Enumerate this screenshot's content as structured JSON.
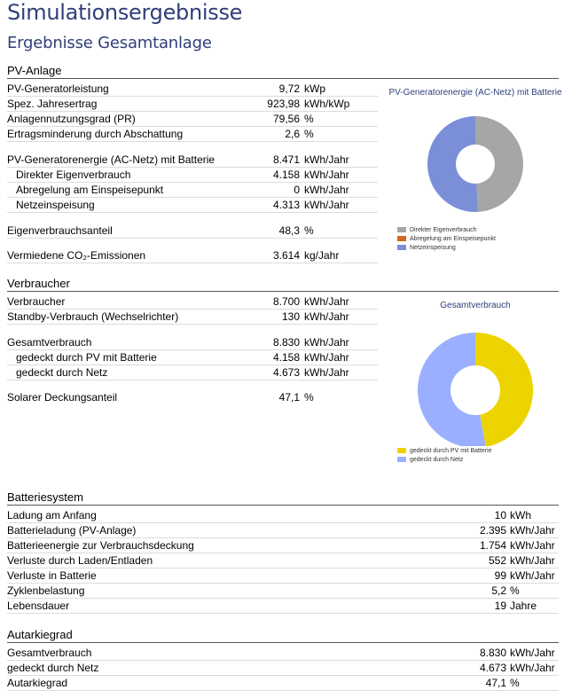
{
  "header": {
    "title": "Simulationsergebnisse",
    "subtitle": "Ergebnisse Gesamtanlage"
  },
  "pv": {
    "title": "PV-Anlage",
    "rows": [
      {
        "label": "PV-Generatorleistung",
        "value": "9,72",
        "unit": "kWp"
      },
      {
        "label": "Spez. Jahresertrag",
        "value": "923,98",
        "unit": "kWh/kWp"
      },
      {
        "label": "Anlagennutzungsgrad (PR)",
        "value": "79,56",
        "unit": "%"
      },
      {
        "label": "Ertragsminderung durch Abschattung",
        "value": "2,6",
        "unit": "%"
      },
      {
        "label": "PV-Generatorenergie (AC-Netz) mit Batterie",
        "value": "8.471",
        "unit": "kWh/Jahr"
      },
      {
        "label": "Direkter Eigenverbrauch",
        "value": "4.158",
        "unit": "kWh/Jahr"
      },
      {
        "label": "Abregelung am Einspeisepunkt",
        "value": "0",
        "unit": "kWh/Jahr"
      },
      {
        "label": "Netzeinspeisung",
        "value": "4.313",
        "unit": "kWh/Jahr"
      },
      {
        "label": "Eigenverbrauchsanteil",
        "value": "48,3",
        "unit": "%"
      },
      {
        "label": "Vermiedene CO₂-Emissionen",
        "value": "3.614",
        "unit": "kg/Jahr"
      }
    ]
  },
  "verbraucher": {
    "title": "Verbraucher",
    "rows": [
      {
        "label": "Verbraucher",
        "value": "8.700",
        "unit": "kWh/Jahr"
      },
      {
        "label": "Standby-Verbrauch (Wechselrichter)",
        "value": "130",
        "unit": "kWh/Jahr"
      },
      {
        "label": "Gesamtverbrauch",
        "value": "8.830",
        "unit": "kWh/Jahr"
      },
      {
        "label": "gedeckt durch PV mit Batterie",
        "value": "4.158",
        "unit": "kWh/Jahr"
      },
      {
        "label": "gedeckt durch Netz",
        "value": "4.673",
        "unit": "kWh/Jahr"
      },
      {
        "label": "Solarer Deckungsanteil",
        "value": "47,1",
        "unit": "%"
      }
    ]
  },
  "batterie": {
    "title": "Batteriesystem",
    "rows": [
      {
        "label": "Ladung am Anfang",
        "value": "10",
        "unit": "kWh"
      },
      {
        "label": "Batterieladung (PV-Anlage)",
        "value": "2.395",
        "unit": "kWh/Jahr"
      },
      {
        "label": "Batterieenergie zur Verbrauchsdeckung",
        "value": "1.754",
        "unit": "kWh/Jahr"
      },
      {
        "label": "Verluste durch Laden/Entladen",
        "value": "552",
        "unit": "kWh/Jahr"
      },
      {
        "label": "Verluste in Batterie",
        "value": "99",
        "unit": "kWh/Jahr"
      },
      {
        "label": "Zyklenbelastung",
        "value": "5,2",
        "unit": "%"
      },
      {
        "label": "Lebensdauer",
        "value": "19",
        "unit": "Jahre"
      }
    ]
  },
  "autarkie": {
    "title": "Autarkiegrad",
    "rows": [
      {
        "label": "Gesamtverbrauch",
        "value": "8.830",
        "unit": "kWh/Jahr"
      },
      {
        "label": "gedeckt durch Netz",
        "value": "4.673",
        "unit": "kWh/Jahr"
      },
      {
        "label": "Autarkiegrad",
        "value": "47,1",
        "unit": "%"
      }
    ]
  },
  "chart_data": [
    {
      "type": "pie",
      "title": "PV-Generatorenergie (AC-Netz) mit Batterie",
      "categories": [
        "Direkter Eigenverbrauch",
        "Abregelung am Einspeisepunkt",
        "Netzeinspeisung"
      ],
      "values": [
        4158,
        0,
        4313
      ],
      "colors": [
        "#a6a6a6",
        "#d4681a",
        "#7a8fd8"
      ],
      "legend": "bottom-left"
    },
    {
      "type": "pie",
      "title": "Gesamtverbrauch",
      "categories": [
        "gedeckt durch PV mit Batterie",
        "gedeckt durch Netz"
      ],
      "values": [
        4158,
        4673
      ],
      "colors": [
        "#ecd400",
        "#9aafff"
      ],
      "legend": "bottom-left"
    }
  ]
}
